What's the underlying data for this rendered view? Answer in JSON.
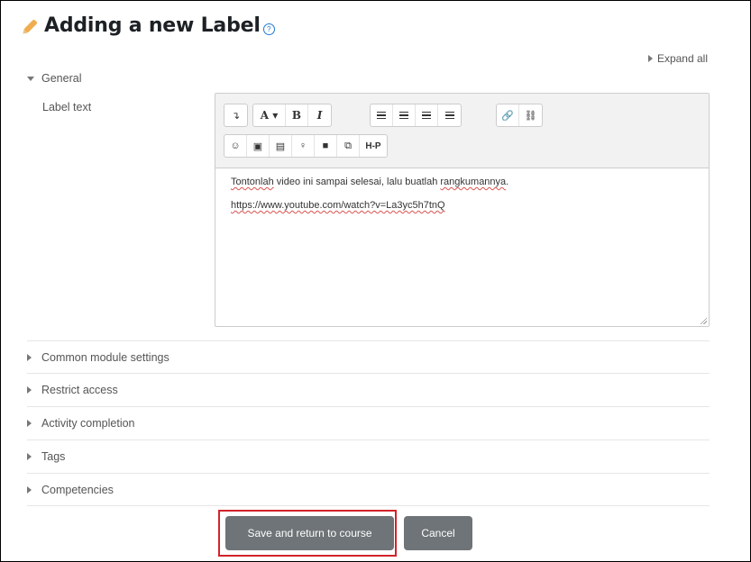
{
  "page": {
    "title": "Adding a new Label",
    "help_icon": "question-circle-icon"
  },
  "form": {
    "expand_all": "Expand all",
    "general_section": "General",
    "label_text_field": "Label text"
  },
  "toolbar": {
    "row1": [
      {
        "name": "toolbar-toggle-button",
        "icon": "show-more-icon",
        "glyph": "↴"
      },
      {
        "name": "font-style-button",
        "icon": "font-style-icon",
        "glyph": "A ▾"
      },
      {
        "name": "bold-button",
        "icon": "bold-icon",
        "glyph": "B"
      },
      {
        "name": "italic-button",
        "icon": "italic-icon",
        "glyph": "I"
      },
      {
        "name": "unordered-list-button",
        "icon": "unordered-list-icon"
      },
      {
        "name": "ordered-list-button",
        "icon": "ordered-list-icon"
      },
      {
        "name": "outdent-button",
        "icon": "outdent-icon"
      },
      {
        "name": "indent-button",
        "icon": "indent-icon"
      },
      {
        "name": "link-button",
        "icon": "link-icon",
        "glyph": "🔗"
      },
      {
        "name": "unlink-button",
        "icon": "unlink-icon",
        "glyph": "⛓"
      }
    ],
    "row2": [
      {
        "name": "emoticon-button",
        "icon": "smiley-icon",
        "glyph": "☺"
      },
      {
        "name": "image-button",
        "icon": "image-icon",
        "glyph": "▣"
      },
      {
        "name": "media-button",
        "icon": "media-file-icon",
        "glyph": "▤"
      },
      {
        "name": "record-audio-button",
        "icon": "microphone-icon",
        "glyph": "♀"
      },
      {
        "name": "record-video-button",
        "icon": "video-camera-icon",
        "glyph": "■"
      },
      {
        "name": "manage-files-button",
        "icon": "files-icon",
        "glyph": "⧉"
      },
      {
        "name": "h5p-button",
        "icon": "h5p-icon",
        "glyph": "H-P"
      }
    ]
  },
  "editor": {
    "line1_words": [
      "Tontonlah",
      " video ini sampai selesai, lalu buatlah ",
      "rangkumannya",
      "."
    ],
    "line2": "https://www.youtube.com/watch?v=La3yc5h7tnQ"
  },
  "sections": [
    "Common module settings",
    "Restrict access",
    "Activity completion",
    "Tags",
    "Competencies"
  ],
  "buttons": {
    "save": "Save and return to course",
    "cancel": "Cancel"
  },
  "colors": {
    "highlight": "#d2232a",
    "button": "#6e7477",
    "help": "#1f7ad1",
    "pencil": "#f0ad4e"
  }
}
